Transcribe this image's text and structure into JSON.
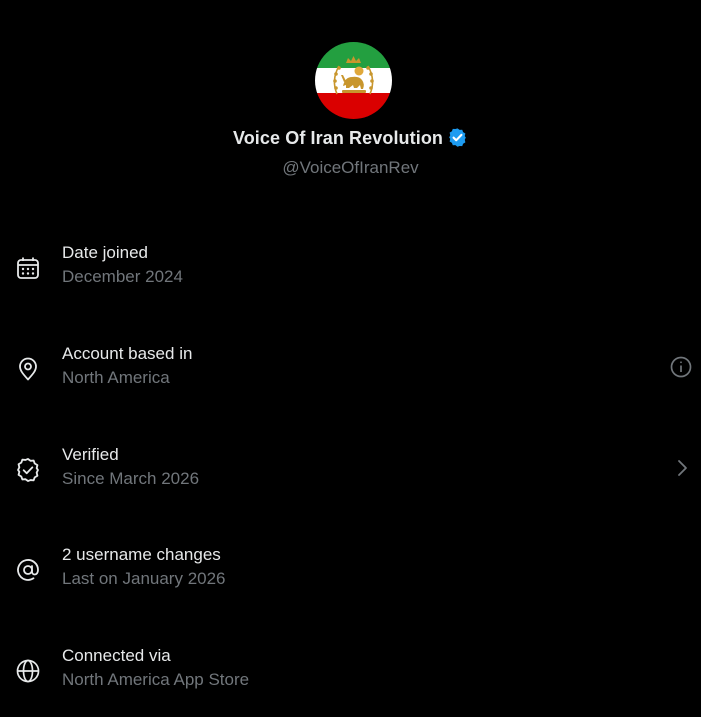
{
  "profile": {
    "display_name": "Voice Of Iran Revolution",
    "handle": "@VoiceOfIranRev",
    "verified": true,
    "avatar_icon": "iran-lion-and-sun-flag-icon"
  },
  "colors": {
    "background": "#000000",
    "primary_text": "#e7e9ea",
    "secondary_text": "#71767b",
    "verified_blue": "#1d9bf0",
    "flag_green": "#239f40",
    "flag_white": "#ffffff",
    "flag_red": "#da0000",
    "emblem_gold": "#c8962d"
  },
  "items": [
    {
      "title": "Date joined",
      "subtitle": "December 2024",
      "icon": "calendar-icon"
    },
    {
      "title": "Account based in",
      "subtitle": "North America",
      "icon": "location-pin-icon",
      "trailing_icon": "info-icon"
    },
    {
      "title": "Verified",
      "subtitle": "Since March 2026",
      "icon": "verified-check-icon",
      "trailing_icon": "chevron-right-icon"
    },
    {
      "title": "2 username changes",
      "subtitle": "Last on January 2026",
      "icon": "at-sign-icon"
    },
    {
      "title": "Connected via",
      "subtitle": "North America App Store",
      "icon": "globe-icon"
    }
  ]
}
